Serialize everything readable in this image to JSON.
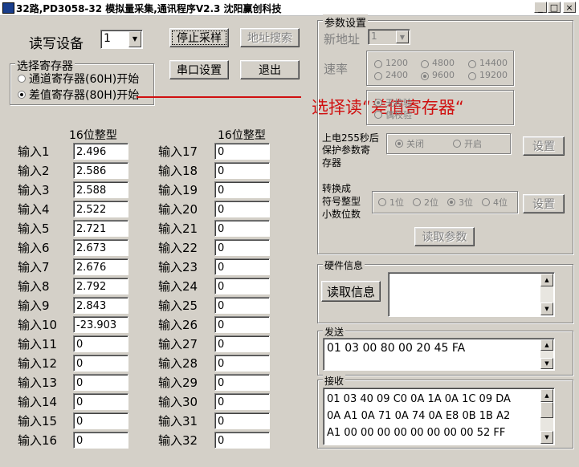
{
  "window": {
    "title": "32路,PD3058-32 模拟量采集,通讯程序V2.3   沈阳赢创科技",
    "minimize": "_",
    "maximize": "□",
    "close": "×"
  },
  "device": {
    "label": "读写设备",
    "value": "1"
  },
  "buttons": {
    "stop": "停止采样",
    "search": "地址搜索",
    "serial": "串口设置",
    "exit": "退出"
  },
  "register_group": {
    "title": "选择寄存器",
    "channel": "通道寄存器(60H)开始",
    "diff": "差值寄存器(80H)开始",
    "selected": "diff"
  },
  "columns": {
    "left_header": "16位整型",
    "right_header": "16位整型"
  },
  "inputs_left": [
    {
      "label": "输入1",
      "value": "2.496"
    },
    {
      "label": "输入2",
      "value": "2.586"
    },
    {
      "label": "输入3",
      "value": "2.588"
    },
    {
      "label": "输入4",
      "value": "2.522"
    },
    {
      "label": "输入5",
      "value": "2.721"
    },
    {
      "label": "输入6",
      "value": "2.673"
    },
    {
      "label": "输入7",
      "value": "2.676"
    },
    {
      "label": "输入8",
      "value": "2.792"
    },
    {
      "label": "输入9",
      "value": "2.843"
    },
    {
      "label": "输入10",
      "value": "-23.903"
    },
    {
      "label": "输入11",
      "value": "0"
    },
    {
      "label": "输入12",
      "value": "0"
    },
    {
      "label": "输入13",
      "value": "0"
    },
    {
      "label": "输入14",
      "value": "0"
    },
    {
      "label": "输入15",
      "value": "0"
    },
    {
      "label": "输入16",
      "value": "0"
    }
  ],
  "inputs_right": [
    {
      "label": "输入17",
      "value": "0"
    },
    {
      "label": "输入18",
      "value": "0"
    },
    {
      "label": "输入19",
      "value": "0"
    },
    {
      "label": "输入20",
      "value": "0"
    },
    {
      "label": "输入21",
      "value": "0"
    },
    {
      "label": "输入22",
      "value": "0"
    },
    {
      "label": "输入23",
      "value": "0"
    },
    {
      "label": "输入24",
      "value": "0"
    },
    {
      "label": "输入25",
      "value": "0"
    },
    {
      "label": "输入26",
      "value": "0"
    },
    {
      "label": "输入27",
      "value": "0"
    },
    {
      "label": "输入28",
      "value": "0"
    },
    {
      "label": "输入29",
      "value": "0"
    },
    {
      "label": "输入30",
      "value": "0"
    },
    {
      "label": "输入31",
      "value": "0"
    },
    {
      "label": "输入32",
      "value": "0"
    }
  ],
  "params": {
    "title": "参数设置",
    "new_address_label": "新地址",
    "new_address_value": "1",
    "baud_label": "速率",
    "baud_options": [
      "1200",
      "4800",
      "14400",
      "2400",
      "9600",
      "19200"
    ],
    "baud_selected": "9600",
    "parity_options": [
      "无校验",
      "偶校验"
    ],
    "power_label_1": "上电255秒后",
    "power_label_2": "保护参数寄",
    "power_label_3": "存器",
    "power_off": "关闭",
    "power_on": "开启",
    "power_set": "设置",
    "dec_label_1": "转换成",
    "dec_label_2": "符号整型",
    "dec_label_3": "小数位数",
    "dec_options": [
      "1位",
      "2位",
      "3位",
      "4位"
    ],
    "dec_selected": "3位",
    "dec_set": "设置",
    "read_params": "读取参数"
  },
  "hardware": {
    "title": "硬件信息",
    "read_button": "读取信息",
    "content": ""
  },
  "send": {
    "title": "发送",
    "content": "01 03 00 80 00 20 45 FA"
  },
  "receive": {
    "title": "接收",
    "lines": [
      "01 03 40 09 C0 0A 1A 0A 1C 09 DA",
      "0A A1 0A 71 0A 74 0A E8 0B 1B A2",
      "A1 00 00 00 00 00 00 00 00 52 FF"
    ]
  },
  "annotation": {
    "text": "选择读“差值寄存器“",
    "color": "#d01010"
  }
}
